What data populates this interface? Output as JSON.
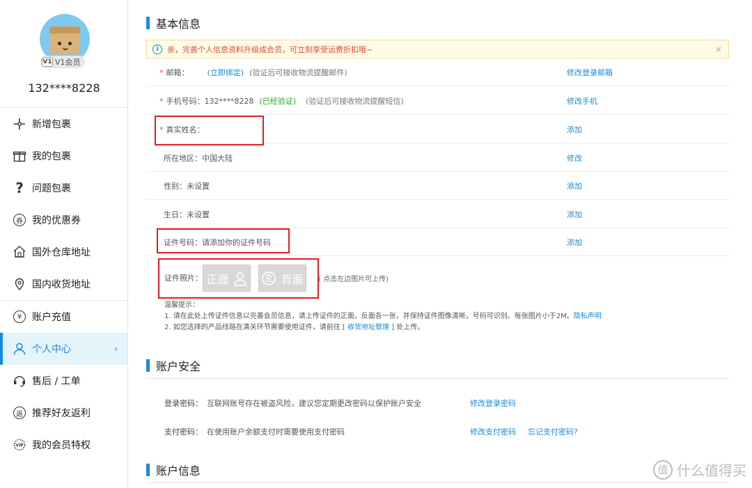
{
  "profile": {
    "vip_icon": "V1",
    "vip_label": "V1会员",
    "phone": "132****8228"
  },
  "sidebar": {
    "items": [
      {
        "label": "新增包裹",
        "icon": "plus-icon"
      },
      {
        "label": "我的包裹",
        "icon": "gift-box-icon"
      },
      {
        "label": "问题包裹",
        "icon": "question-icon"
      },
      {
        "label": "我的优惠券",
        "icon": "coupon-icon",
        "glyph": "券"
      },
      {
        "label": "国外仓库地址",
        "icon": "warehouse-icon"
      },
      {
        "label": "国内收货地址",
        "icon": "location-pin-icon"
      },
      {
        "label": "账户充值",
        "icon": "yen-icon",
        "glyph": "¥"
      },
      {
        "label": "个人中心",
        "icon": "person-icon",
        "active": true
      },
      {
        "label": "售后 / 工单",
        "icon": "headset-icon"
      },
      {
        "label": "推荐好友返利",
        "icon": "rebate-icon",
        "glyph": "返"
      },
      {
        "label": "我的会员特权",
        "icon": "vip-privilege-icon"
      }
    ]
  },
  "basic_info": {
    "title": "基本信息",
    "notice": "亲，完善个人信息资料升级成会员，可立刻享受运费折扣哦~",
    "notice_close": "×",
    "email": {
      "label": "邮箱：",
      "bind_link": "(立即绑定)",
      "note": "(验证后可接收物流提醒邮件)",
      "action": "修改登录邮箱"
    },
    "mobile": {
      "label": "手机号码：132****8228",
      "verified": "(已经验证)",
      "note": "(验证后可接收物流提醒短信)",
      "action": "修改手机"
    },
    "real_name": {
      "label": "真实姓名：",
      "action": "添加"
    },
    "region": {
      "label": "所在地区：中国大陆",
      "action": "修改"
    },
    "gender": {
      "label": "性别：未设置",
      "action": "添加"
    },
    "birthday": {
      "label": "生日：未设置",
      "action": "添加"
    },
    "id_number": {
      "label": "证件号码：请添加你的证件号码",
      "action": "添加"
    },
    "id_photo": {
      "label": "证件照片：",
      "front": "正面",
      "back": "背面",
      "note": "( 点击左边图片可上传)"
    },
    "tips": {
      "title": "温馨提示：",
      "line1": "1. 请在此处上传证件信息以完善会员信息，请上传证件的正面，反面各一张，并保持证件图像清晰，号码可识别。每张图片小于2M。",
      "privacy_link": "隐私声明",
      "line2_pre": "2. 如您选择的产品线路在清关环节需要使用证件，请前往 [",
      "address_link": "收货地址管理",
      "line2_post": "] 处上传。"
    }
  },
  "account_security": {
    "title": "账户安全",
    "login_pwd": {
      "label": "登录密码：",
      "desc": "互联网账号存在被盗风险，建议您定期更改密码以保护账户安全",
      "action": "修改登录密码"
    },
    "pay_pwd": {
      "label": "支付密码：",
      "desc": "在使用账户余额支付时需要使用支付密码",
      "action": "修改支付密码",
      "forgot": "忘记支付密码?"
    }
  },
  "account_info": {
    "title": "账户信息"
  },
  "watermark": {
    "icon": "值",
    "text": "什么值得买"
  },
  "colors": {
    "accent": "#1a8ad7",
    "alert_red": "#e21a24",
    "verified_green": "#2aa52a"
  }
}
